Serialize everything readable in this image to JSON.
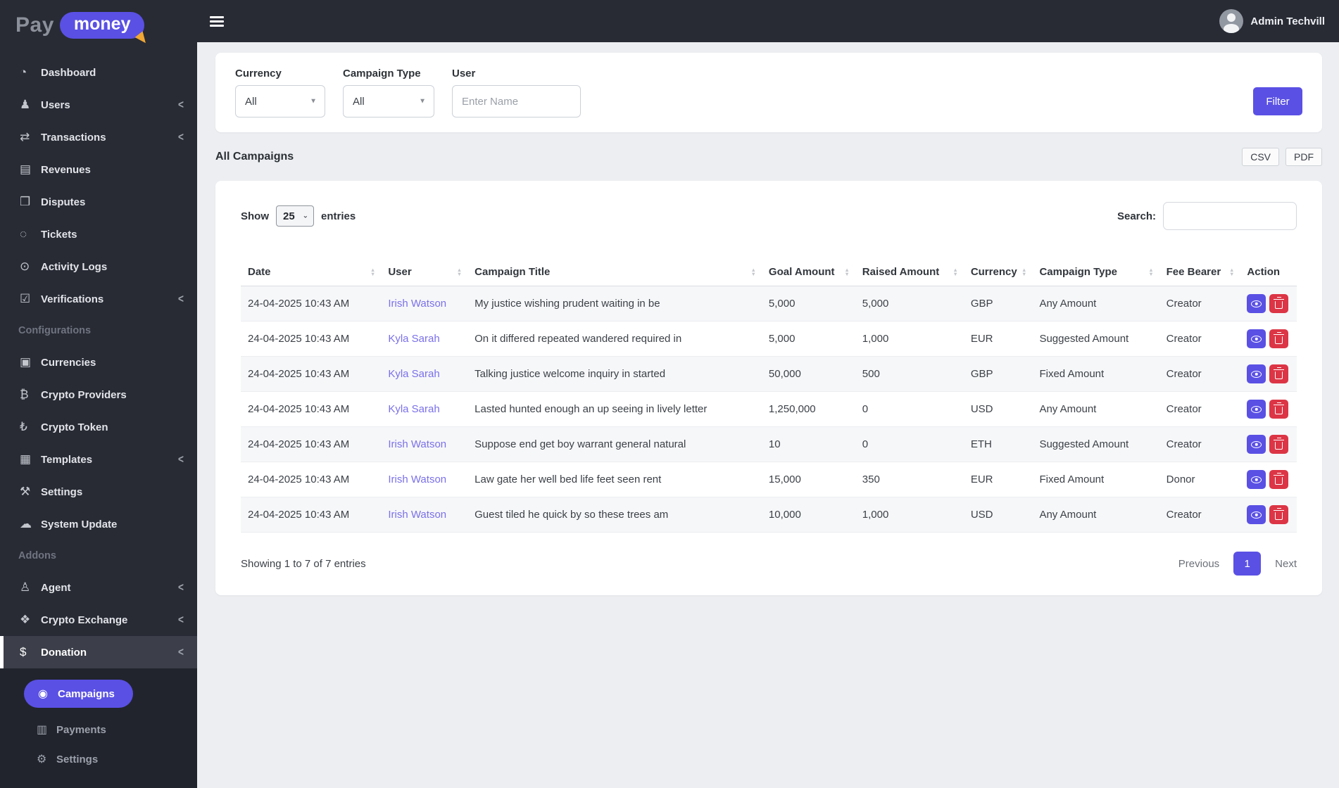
{
  "brand": {
    "part1": "Pay",
    "part2": "money"
  },
  "topbar": {
    "user_name": "Admin Techvill"
  },
  "colors": {
    "accent": "#5a50e4",
    "danger": "#dc3545",
    "link": "#7a70ea",
    "sidebar_bg": "#282b34",
    "content_bg": "#eceef1",
    "active_item_bg": "#3c3f49"
  },
  "sidebar": {
    "items": [
      {
        "label": "Dashboard",
        "icon": "dashboard-icon"
      },
      {
        "label": "Users",
        "icon": "users-icon",
        "chevron": true
      },
      {
        "label": "Transactions",
        "icon": "transactions-icon",
        "chevron": true
      },
      {
        "label": "Revenues",
        "icon": "revenues-icon"
      },
      {
        "label": "Disputes",
        "icon": "disputes-icon"
      },
      {
        "label": "Tickets",
        "icon": "tickets-icon"
      },
      {
        "label": "Activity Logs",
        "icon": "activity-logs-icon"
      },
      {
        "label": "Verifications",
        "icon": "verifications-icon",
        "chevron": true
      },
      {
        "type": "header",
        "label": "Configurations"
      },
      {
        "label": "Currencies",
        "icon": "currencies-icon"
      },
      {
        "label": "Crypto Providers",
        "icon": "crypto-providers-icon"
      },
      {
        "label": "Crypto Token",
        "icon": "crypto-token-icon"
      },
      {
        "label": "Templates",
        "icon": "templates-icon",
        "chevron": true
      },
      {
        "label": "Settings",
        "icon": "settings-icon"
      },
      {
        "label": "System Update",
        "icon": "system-update-icon"
      },
      {
        "type": "header",
        "label": "Addons"
      },
      {
        "label": "Agent",
        "icon": "agent-icon",
        "chevron": true
      },
      {
        "label": "Crypto Exchange",
        "icon": "crypto-exchange-icon",
        "chevron": true
      },
      {
        "label": "Donation",
        "icon": "donation-icon",
        "chevron": true,
        "active": true
      }
    ],
    "submenu": [
      {
        "label": "Campaigns",
        "icon": "campaigns-icon",
        "active": true
      },
      {
        "label": "Payments",
        "icon": "payments-icon"
      },
      {
        "label": "Settings",
        "icon": "donation-settings-icon"
      }
    ]
  },
  "filters": {
    "currency_label": "Currency",
    "currency_value": "All",
    "campaign_type_label": "Campaign Type",
    "campaign_type_value": "All",
    "user_label": "User",
    "user_placeholder": "Enter Name",
    "filter_button": "Filter"
  },
  "page": {
    "title": "All Campaigns",
    "csv": "CSV",
    "pdf": "PDF"
  },
  "table_controls": {
    "show": "Show",
    "page_size": "25",
    "entries": "entries",
    "search_label": "Search:",
    "search_value": ""
  },
  "table": {
    "columns": [
      "Date",
      "User",
      "Campaign Title",
      "Goal Amount",
      "Raised Amount",
      "Currency",
      "Campaign Type",
      "Fee Bearer",
      "Action"
    ],
    "rows": [
      {
        "date": "24-04-2025 10:43 AM",
        "user": "Irish Watson",
        "title": "My justice wishing prudent waiting in be",
        "goal": "5,000",
        "raised": "5,000",
        "currency": "GBP",
        "type": "Any Amount",
        "fee_bearer": "Creator"
      },
      {
        "date": "24-04-2025 10:43 AM",
        "user": "Kyla Sarah",
        "title": "On it differed repeated wandered required in",
        "goal": "5,000",
        "raised": "1,000",
        "currency": "EUR",
        "type": "Suggested Amount",
        "fee_bearer": "Creator"
      },
      {
        "date": "24-04-2025 10:43 AM",
        "user": "Kyla Sarah",
        "title": "Talking justice welcome inquiry in started",
        "goal": "50,000",
        "raised": "500",
        "currency": "GBP",
        "type": "Fixed Amount",
        "fee_bearer": "Creator"
      },
      {
        "date": "24-04-2025 10:43 AM",
        "user": "Kyla Sarah",
        "title": "Lasted hunted enough an up seeing in lively letter",
        "goal": "1,250,000",
        "raised": "0",
        "currency": "USD",
        "type": "Any Amount",
        "fee_bearer": "Creator"
      },
      {
        "date": "24-04-2025 10:43 AM",
        "user": "Irish Watson",
        "title": "Suppose end get boy warrant general natural",
        "goal": "10",
        "raised": "0",
        "currency": "ETH",
        "type": "Suggested Amount",
        "fee_bearer": "Creator"
      },
      {
        "date": "24-04-2025 10:43 AM",
        "user": "Irish Watson",
        "title": "Law gate her well bed life feet seen rent",
        "goal": "15,000",
        "raised": "350",
        "currency": "EUR",
        "type": "Fixed Amount",
        "fee_bearer": "Donor"
      },
      {
        "date": "24-04-2025 10:43 AM",
        "user": "Irish Watson",
        "title": "Guest tiled he quick by so these trees am",
        "goal": "10,000",
        "raised": "1,000",
        "currency": "USD",
        "type": "Any Amount",
        "fee_bearer": "Creator"
      }
    ]
  },
  "footer": {
    "summary": "Showing 1 to 7 of 7 entries",
    "previous": "Previous",
    "current_page": "1",
    "next": "Next"
  }
}
